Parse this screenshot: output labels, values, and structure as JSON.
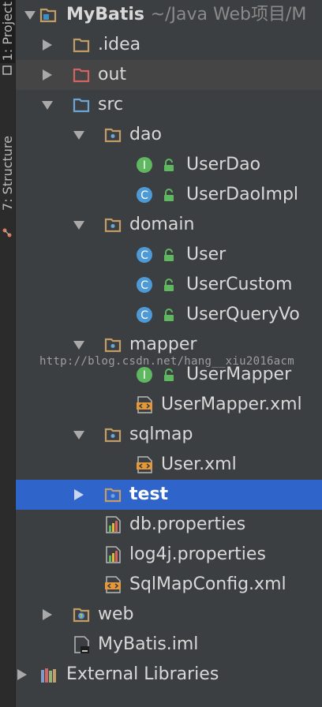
{
  "tool_strip": {
    "project_tab": "1: Project",
    "structure_tab": "7: Structure"
  },
  "tree": {
    "root_label": "MyBatis",
    "root_path": "~/Java Web项目/M",
    "items": {
      "idea": ".idea",
      "out": "out",
      "src": "src",
      "dao": "dao",
      "user_dao": "UserDao",
      "user_dao_impl": "UserDaoImpl",
      "domain": "domain",
      "user": "User",
      "user_custom": "UserCustom",
      "user_query_vo": "UserQueryVo",
      "mapper": "mapper",
      "user_mapper": "UserMapper",
      "user_mapper_xml": "UserMapper.xml",
      "sqlmap": "sqlmap",
      "user_xml": "User.xml",
      "test": "test",
      "db_properties": "db.properties",
      "log4j_properties": "log4j.properties",
      "sqlmapconfig_xml": "SqlMapConfig.xml",
      "web": "web",
      "mybatis_iml": "MyBatis.iml",
      "external_libraries": "External Libraries"
    },
    "selected": "test"
  },
  "watermark": "http://blog.csdn.net/hang__xiu2016acm",
  "colors": {
    "background": "#3c3f41",
    "selection": "#2f65ca",
    "folder": "#c39d68",
    "excluded_folder": "#d46363",
    "source_folder": "#6aa6d8",
    "interface_badge": "#5fb760",
    "class_badge": "#4d9ad6",
    "xml_badge": "#e69838"
  }
}
